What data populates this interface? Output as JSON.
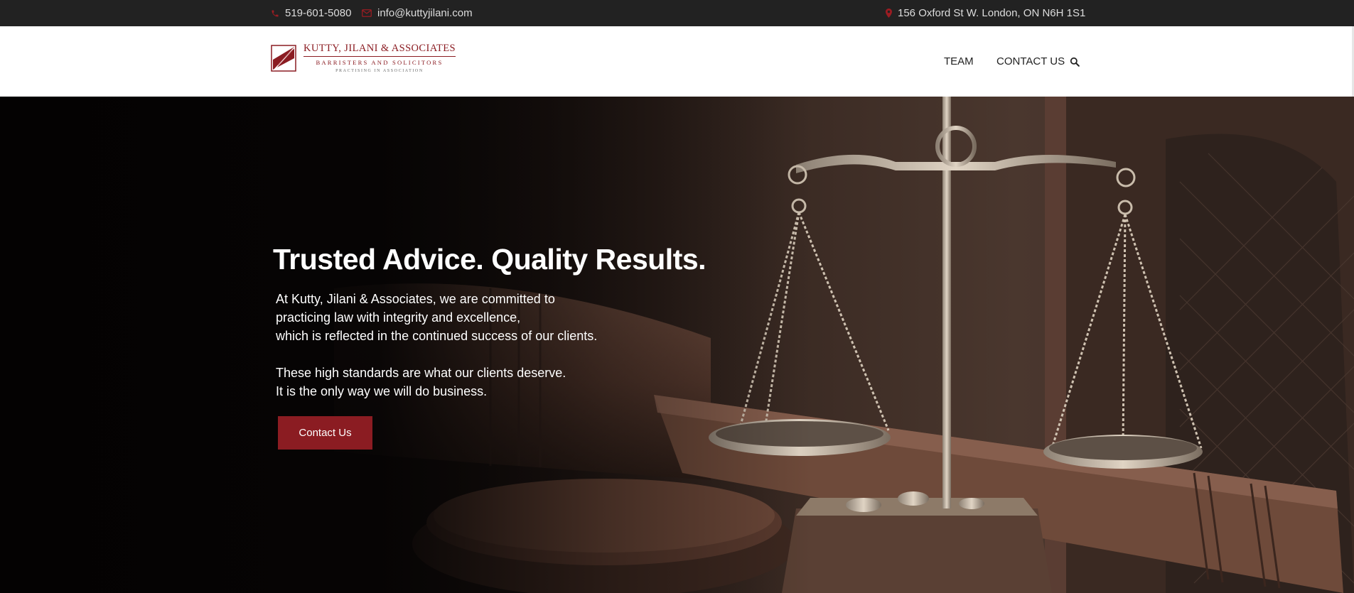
{
  "topbar": {
    "phone": "519-601-5080",
    "email": "info@kuttyjilani.com",
    "address": "156 Oxford St W. London, ON N6H 1S1",
    "icons": {
      "phone": "phone-icon",
      "email": "envelope-icon",
      "address": "map-marker-icon"
    }
  },
  "logo": {
    "name": "KUTTY, JILANI & ASSOCIATES",
    "subtitle": "BARRISTERS AND SOLICITORS",
    "tagline": "PRACTISING IN ASSOCIATION"
  },
  "nav": {
    "items": [
      {
        "label": "TEAM"
      },
      {
        "label": "CONTACT US"
      }
    ],
    "search_icon": "search-icon"
  },
  "hero": {
    "title": "Trusted Advice. Quality Results.",
    "paragraph1": [
      "At Kutty, Jilani & Associates, we are committed to",
      "practicing law with integrity and excellence,",
      "which is reflected in the continued success of our clients."
    ],
    "paragraph2": [
      "These high standards are what our clients deserve.",
      "It is the only way we will do business."
    ],
    "button_label": "Contact Us"
  },
  "colors": {
    "accent": "#8b1c22",
    "topbar_bg": "#222222",
    "header_bg": "#ffffff"
  }
}
